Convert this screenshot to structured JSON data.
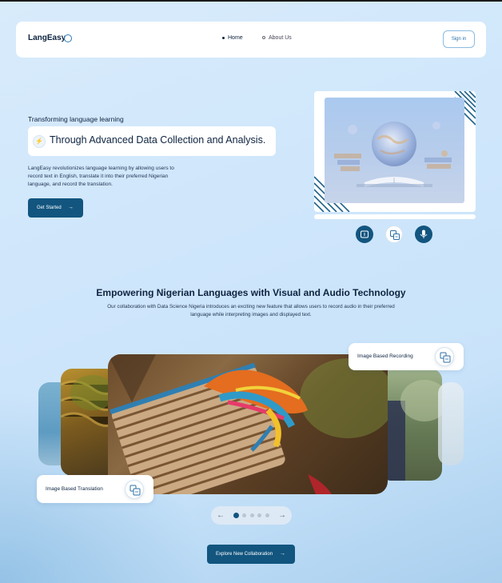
{
  "brand": {
    "name": "LangEasy",
    "accent": "#12557f"
  },
  "nav": {
    "items": [
      {
        "label": "Home",
        "active": true
      },
      {
        "label": "About Us",
        "active": false
      }
    ],
    "signin_label": "Sign in"
  },
  "hero": {
    "eyebrow": "Transforming language learning",
    "headline": "Through Advanced Data Collection and Analysis.",
    "description": "LangEasy revolutionizes language learning by allowing users to record text in English, translate it into their preferred Nigerian language, and record the translation.",
    "cta_label": "Get Started",
    "cta_icon": "arrow-right-icon",
    "action_icons": [
      "text-input-icon",
      "translate-icon",
      "microphone-icon"
    ]
  },
  "section": {
    "title": "Empowering Nigerian Languages with Visual and Audio Technology",
    "description": "Our collaboration with Data Science Nigeria introduces an exciting new feature that allows users to record audio in their preferred language while interpreting images and displayed text."
  },
  "carousel": {
    "recording_chip": "Image Based Recording",
    "translation_chip": "Image Based Translation",
    "chip_icon": "translate-icon",
    "pager": {
      "total": 5,
      "active_index": 0
    }
  },
  "explore": {
    "label": "Explore New Collaboration",
    "icon": "arrow-right-icon"
  }
}
